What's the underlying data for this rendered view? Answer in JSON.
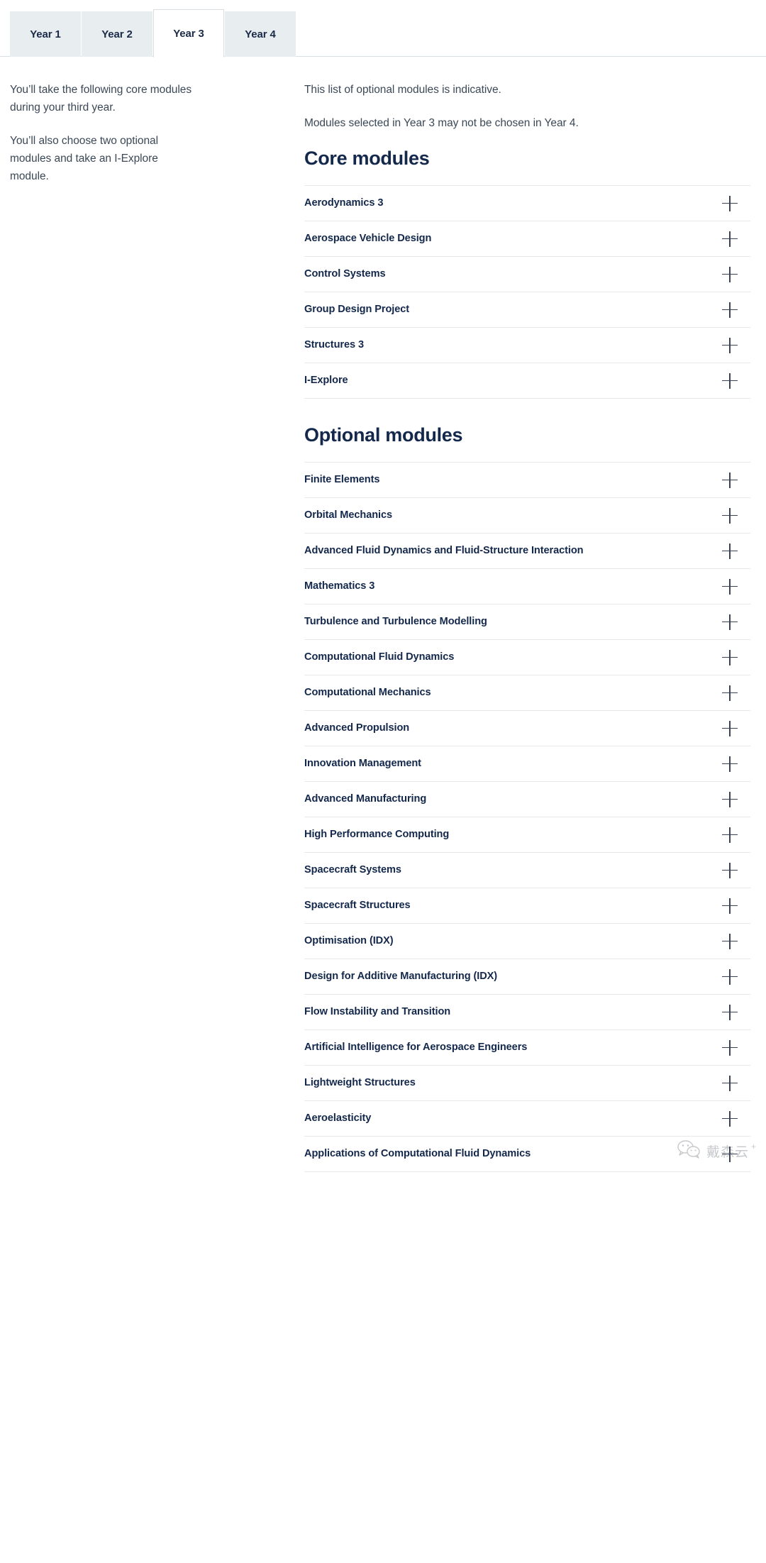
{
  "tabs": {
    "items": [
      {
        "label": "Year 1",
        "active": false
      },
      {
        "label": "Year 2",
        "active": false
      },
      {
        "label": "Year 3",
        "active": true
      },
      {
        "label": "Year 4",
        "active": false
      }
    ]
  },
  "left_column": {
    "paragraph_1": "You’ll take the following core modules during your third year.",
    "paragraph_2": "You’ll also choose two optional modules and take an I-Explore module."
  },
  "right_column": {
    "note_1": "This list of optional modules is indicative.",
    "note_2": "Modules selected in Year 3 may not be chosen in Year 4.",
    "core_heading": "Core modules",
    "optional_heading": "Optional modules",
    "core_modules": [
      "Aerodynamics 3",
      "Aerospace Vehicle Design",
      "Control Systems",
      "Group Design Project",
      "Structures 3",
      "I-Explore"
    ],
    "optional_modules": [
      "Finite Elements",
      "Orbital Mechanics",
      "Advanced Fluid Dynamics and Fluid-Structure Interaction",
      "Mathematics 3",
      "Turbulence and Turbulence Modelling",
      "Computational Fluid Dynamics",
      "Computational Mechanics",
      "Advanced Propulsion",
      "Innovation Management",
      "Advanced Manufacturing",
      "High Performance Computing",
      "Spacecraft Systems",
      "Spacecraft Structures",
      "Optimisation (IDX)",
      "Design for Additive Manufacturing (IDX)",
      "Flow Instability and Transition",
      "Artificial Intelligence for Aerospace Engineers",
      "Lightweight Structures",
      "Aeroelasticity",
      "Applications of Computational Fluid Dynamics"
    ],
    "expand_icon": "plus-icon"
  },
  "watermark": {
    "text": "戴森云",
    "plus": "+",
    "icon": "wechat-icon"
  },
  "colors": {
    "heading": "#14284b",
    "body_text": "#3b4856",
    "tab_inactive_bg": "#e8edf0",
    "tab_active_bg": "#ffffff",
    "divider": "#e6e9ec",
    "page_bg": "#ffffff"
  }
}
